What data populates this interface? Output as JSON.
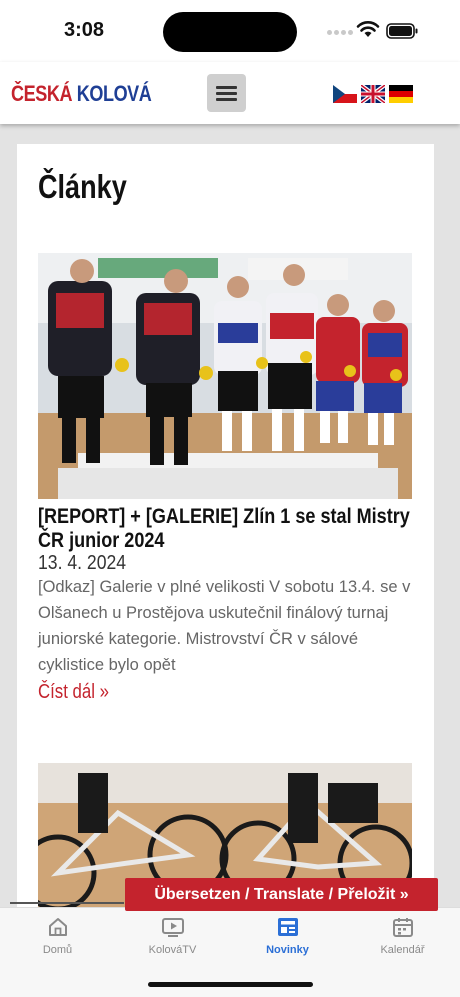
{
  "status_bar": {
    "time": "3:08"
  },
  "header": {
    "logo_word1": "ČESKÁ",
    "logo_word2": "KOLOVÁ",
    "flags": [
      "czech-flag-icon",
      "uk-flag-icon",
      "german-flag-icon"
    ]
  },
  "main": {
    "page_title": "Články",
    "articles": [
      {
        "title": "[REPORT] + [GALERIE] Zlín 1 se stal Mistry ČR junior 2024",
        "date": "13. 4. 2024",
        "excerpt": "[Odkaz] Galerie v plné velikosti V sobotu 13.4. se v Olšanech u Prostějova uskutečnil finálový turnaj juniorské kategorie. Mistrovství ČR v sálové cyklistice bylo opět",
        "read_more": "Číst dál »"
      }
    ]
  },
  "translate_button": "Übersetzen / Translate / Přeložit »",
  "tabs": [
    {
      "label": "Domů",
      "icon": "home-icon"
    },
    {
      "label": "KolováTV",
      "icon": "video-icon"
    },
    {
      "label": "Novinky",
      "icon": "news-icon",
      "active": true
    },
    {
      "label": "Kalendář",
      "icon": "calendar-icon"
    }
  ],
  "colors": {
    "brand_red": "#c4232d",
    "brand_blue": "#1f3f95",
    "active_tab": "#2b6fd6"
  }
}
